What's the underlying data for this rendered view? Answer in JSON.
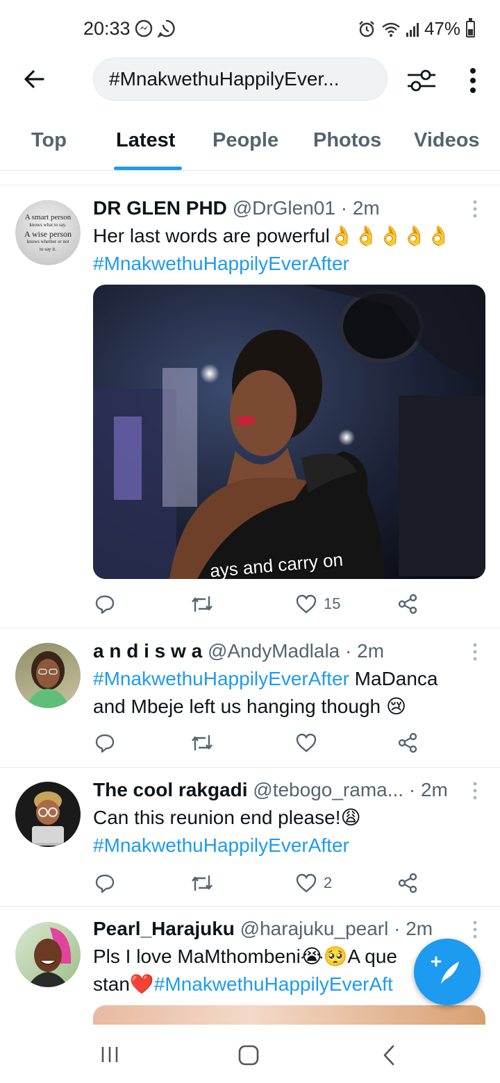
{
  "status_bar": {
    "time": "20:33",
    "battery": "47%"
  },
  "header": {
    "search_query": "#MnakwethuHappilyEver..."
  },
  "tabs": [
    {
      "label": "Top"
    },
    {
      "label": "Latest"
    },
    {
      "label": "People"
    },
    {
      "label": "Photos"
    },
    {
      "label": "Videos"
    }
  ],
  "tweets": [
    {
      "display_name": "DR GLEN PHD",
      "handle": "@DrGlen01",
      "time": "2m",
      "text": "Her last words are powerful👌👌👌👌👌",
      "hashtag": "#MnakwethuHappilyEverAfter",
      "avatar_text": [
        "A smart person",
        "knows what to say.",
        "A wise person",
        "knows whether or not",
        "to say it."
      ],
      "media_caption": "ays and carry on",
      "like_count": "15"
    },
    {
      "display_name": "a n d i s w a",
      "handle": "@AndyMadlala",
      "time": "2m",
      "hashtag": "#MnakwethuHappilyEverAfter",
      "text_after": " MaDanca",
      "text_line2": "and Mbeje left us hanging though 😢",
      "like_count": ""
    },
    {
      "display_name": "The cool rakgadi",
      "handle": "@tebogo_rama...",
      "time": "2m",
      "text": "Can this reunion end please!😩",
      "hashtag": "#MnakwethuHappilyEverAfter",
      "like_count": "2"
    },
    {
      "display_name": "Pearl_Harajuku",
      "handle": "@harajuku_pearl",
      "time": "2m",
      "text": "Pls I love MaMthombeni😭🥺A que",
      "text_line2_prefix": "stan❤️",
      "hashtag": "#MnakwethuHappilyEverAft"
    }
  ],
  "colors": {
    "accent": "#1d9bf0",
    "text": "#0f1419",
    "secondary": "#536471"
  }
}
